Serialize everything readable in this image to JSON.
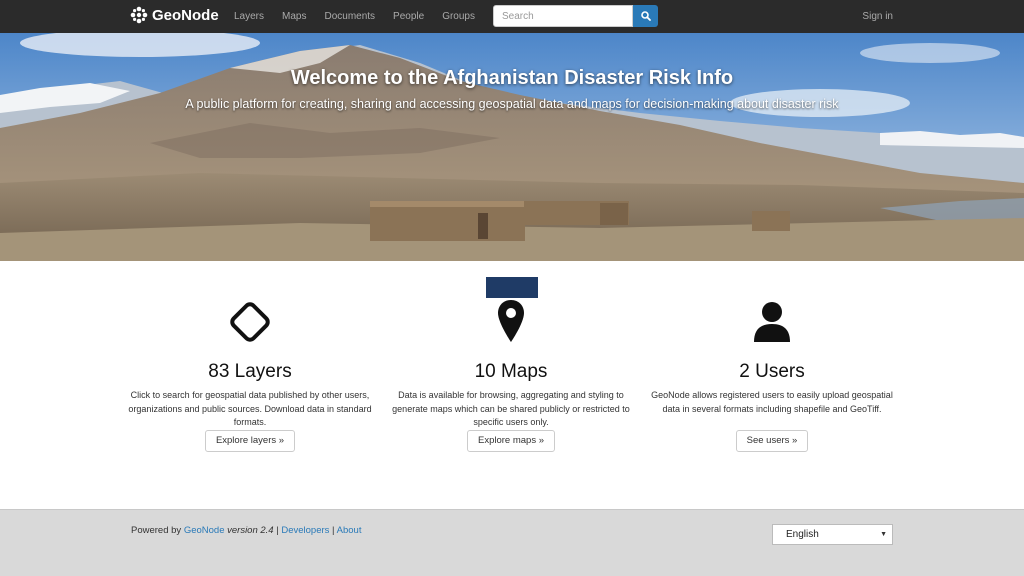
{
  "navbar": {
    "brand": "GeoNode",
    "links": [
      "Layers",
      "Maps",
      "Documents",
      "People",
      "Groups"
    ],
    "search_placeholder": "Search",
    "signin": "Sign in"
  },
  "hero": {
    "title": "Welcome to the Afghanistan Disaster Risk Info",
    "subtitle": "A public platform for creating, sharing and accessing geospatial data and maps for decision-making about disaster risk"
  },
  "features": [
    {
      "icon": "diamond-icon",
      "heading": "83 Layers",
      "text": "Click to search for geospatial data published by other users, organizations and public sources. Download data in standard formats.",
      "button": "Explore layers »"
    },
    {
      "icon": "map-marker-icon",
      "heading": "10 Maps",
      "text": "Data is available for browsing, aggregating and styling to generate maps which can be shared publicly or restricted to specific users only.",
      "button": "Explore maps »"
    },
    {
      "icon": "user-icon",
      "heading": "2 Users",
      "text": "GeoNode allows registered users to easily upload geospatial data in several formats including shapefile and GeoTiff.",
      "button": "See users »"
    }
  ],
  "footer": {
    "powered_prefix": "Powered by ",
    "geonode_link": "GeoNode",
    "version": " version 2.4",
    "sep1": " | ",
    "developers": "Developers",
    "sep2": " | ",
    "about": "About",
    "language": "English"
  },
  "colors": {
    "navbar": "#2b2b2b",
    "accent": "#2a7ab8",
    "footer": "#d9d9d9"
  }
}
